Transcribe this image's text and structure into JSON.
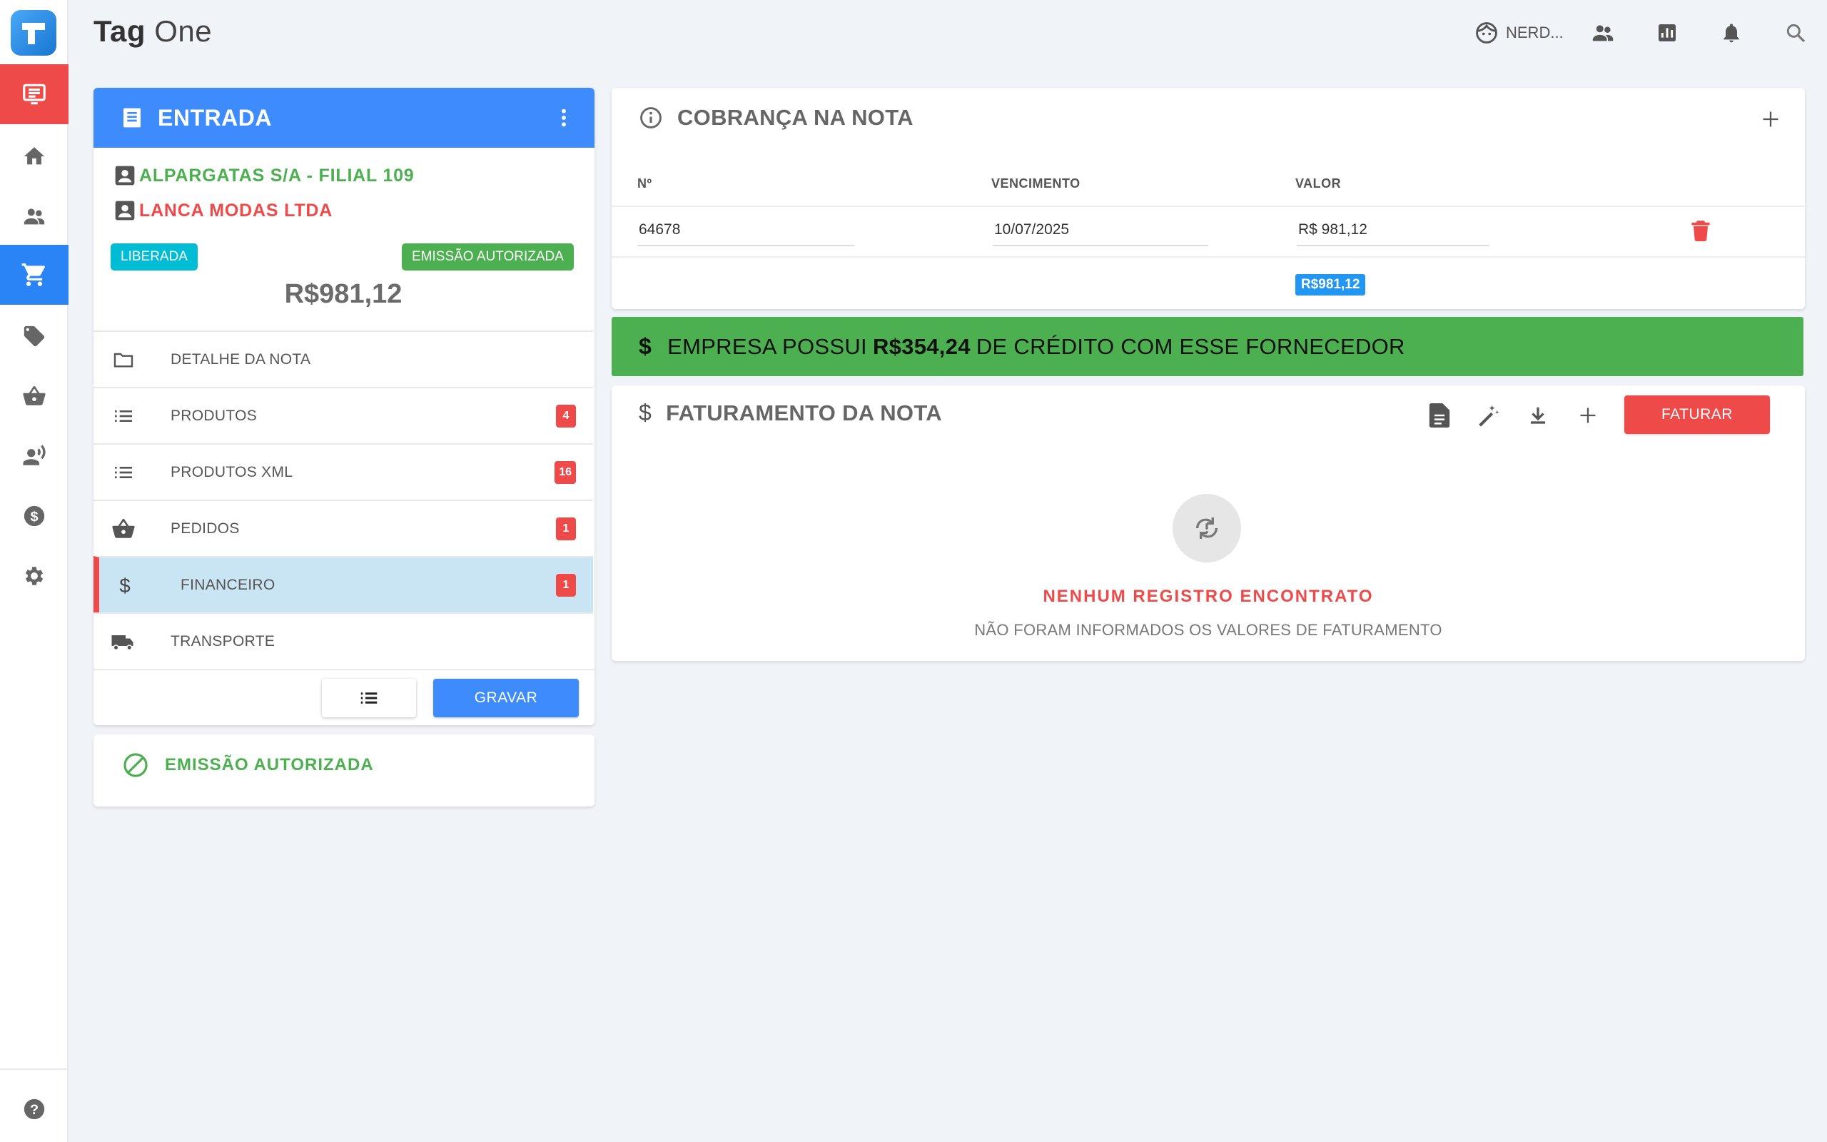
{
  "app": {
    "title_bold": "Tag",
    "title_light": "One"
  },
  "header": {
    "user_name": "NERD..."
  },
  "colors": {
    "primary": "#3d8bfd",
    "danger": "#ef4a4a",
    "success": "#4caf50",
    "info": "#00bcd4"
  },
  "entrada": {
    "title": "ENTRADA",
    "supplier": "ALPARGATAS S/A - FILIAL 109",
    "company": "LANCA MODAS LTDA",
    "status_badge": "LIBERADA",
    "emission_badge": "EMISSÃO AUTORIZADA",
    "total": "R$981,12",
    "menu": [
      {
        "label": "DETALHE DA NOTA",
        "icon": "folder-icon",
        "count": ""
      },
      {
        "label": "PRODUTOS",
        "icon": "list-icon",
        "count": "4"
      },
      {
        "label": "PRODUTOS XML",
        "icon": "list-icon",
        "count": "16"
      },
      {
        "label": "PEDIDOS",
        "icon": "basket-icon",
        "count": "1"
      },
      {
        "label": "FINANCEIRO",
        "icon": "dollar-icon",
        "count": "1"
      },
      {
        "label": "TRANSPORTE",
        "icon": "truck-icon",
        "count": ""
      }
    ],
    "save_label": "GRAVAR"
  },
  "emissao_card": {
    "label": "EMISSÃO AUTORIZADA"
  },
  "cobranca": {
    "title": "COBRANÇA NA NOTA",
    "columns": [
      "Nº",
      "VENCIMENTO",
      "VALOR"
    ],
    "rows": [
      {
        "numero": "64678",
        "vencimento": "10/07/2025",
        "valor": "R$ 981,12"
      }
    ],
    "sum": "R$981,12"
  },
  "credit_banner": {
    "prefix": "EMPRESA POSSUI",
    "amount": "R$354,24",
    "suffix": "DE CRÉDITO COM ESSE FORNECEDOR"
  },
  "faturamento": {
    "title": "FATURAMENTO DA NOTA",
    "button_label": "FATURAR",
    "empty_title": "NENHUM REGISTRO ENCONTRATO",
    "empty_subtitle": "NÃO FORAM INFORMADOS OS VALORES DE FATURAMENTO"
  }
}
